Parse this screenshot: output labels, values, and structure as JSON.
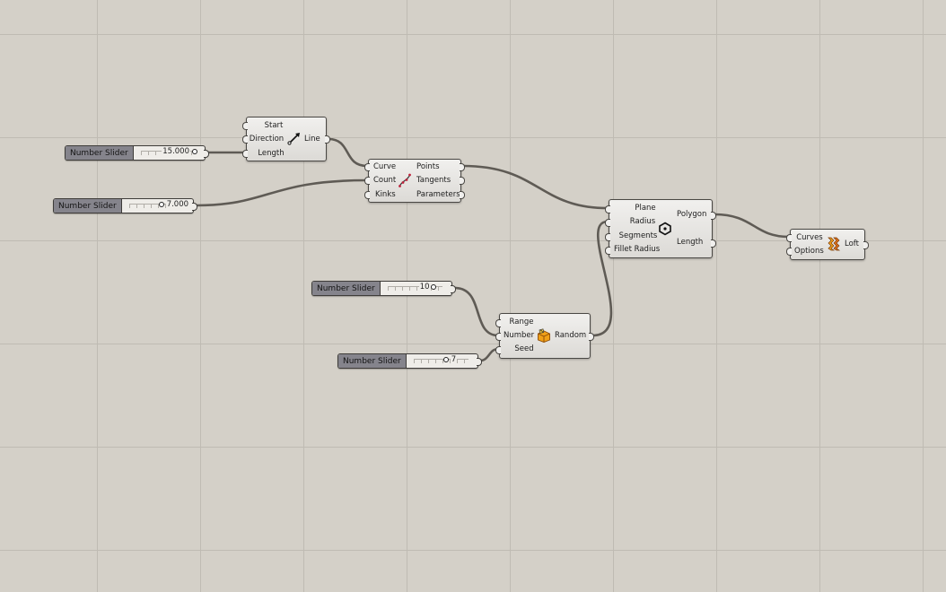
{
  "sliders": [
    {
      "label": "Number Slider",
      "value": "15.000"
    },
    {
      "label": "Number Slider",
      "value": "7.000"
    },
    {
      "label": "Number Slider",
      "value": "10"
    },
    {
      "label": "Number Slider",
      "value": "7"
    }
  ],
  "line": {
    "inputs": [
      "Start",
      "Direction",
      "Length"
    ],
    "output": "Line"
  },
  "divide": {
    "inputs": [
      "Curve",
      "Count",
      "Kinks"
    ],
    "outputs": [
      "Points",
      "Tangents",
      "Parameters"
    ]
  },
  "polygon": {
    "inputs": [
      "Plane",
      "Radius",
      "Segments",
      "Fillet Radius"
    ],
    "outputs": [
      "Polygon",
      "Length"
    ]
  },
  "random": {
    "inputs": [
      "Range",
      "Number",
      "Seed"
    ],
    "output": "Random"
  },
  "loft": {
    "inputs": [
      "Curves",
      "Options"
    ],
    "output": "Loft"
  },
  "icons": [
    "line-sdl-icon",
    "divide-curve-icon",
    "polygon-icon",
    "random-icon",
    "loft-icon"
  ],
  "colors": {
    "canvas": "#d4d0c8",
    "grid": "#bfbbb3",
    "wire": "#5f5b55",
    "slider_label": "#85848c"
  }
}
